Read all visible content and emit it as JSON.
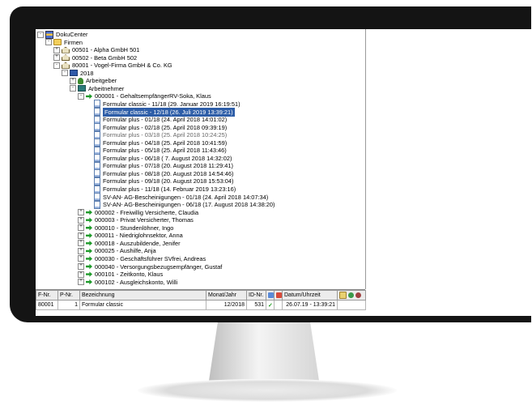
{
  "tree": [
    {
      "label": "DokuCenter",
      "icon": "database-icon",
      "level": 0,
      "exp": "-"
    },
    {
      "label": "Firmen",
      "icon": "folder-icon",
      "level": 1,
      "exp": "-"
    },
    {
      "label": "00501 - Alpha GmbH 501",
      "icon": "building-icon",
      "level": 2,
      "exp": "+"
    },
    {
      "label": "00502 - Beta GmbH 502",
      "icon": "building-icon",
      "level": 2,
      "exp": "+"
    },
    {
      "label": "80001 - Vogel-Firma GmbH & Co. KG",
      "icon": "building-icon",
      "level": 2,
      "exp": "-"
    },
    {
      "label": "2018",
      "icon": "calendar-folder-icon",
      "level": 3,
      "exp": "-"
    },
    {
      "label": "Arbeitgeber",
      "icon": "employer-icon",
      "level": 4,
      "exp": "+"
    },
    {
      "label": "Arbeitnehmer",
      "icon": "employees-icon",
      "level": 4,
      "exp": "-"
    },
    {
      "label": "000001 - GehaltsempfängerRV-Soka, Klaus",
      "icon": "arrow-icon",
      "level": 5,
      "exp": "-"
    },
    {
      "label": "Formular classic - 11/18  (29. Januar 2019 16:19:51)",
      "icon": "document-icon",
      "level": 6
    },
    {
      "label": "Formular classic - 12/18  (26. Juli 2019 13:39:21)",
      "icon": "document-icon",
      "level": 6,
      "selected": true
    },
    {
      "label": "Formular plus - 01/18  (24. April 2018 14:01:02)",
      "icon": "document-icon",
      "level": 6
    },
    {
      "label": "Formular plus - 02/18  (25. April 2018 09:39:19)",
      "icon": "document-icon",
      "level": 6
    },
    {
      "label": "Formular plus - 03/18  (25. April 2018 10:24:25)",
      "icon": "document-icon",
      "level": 6,
      "dim": true
    },
    {
      "label": "Formular plus - 04/18  (25. April 2018 10:41:59)",
      "icon": "document-icon",
      "level": 6
    },
    {
      "label": "Formular plus - 05/18  (25. April 2018 11:43:46)",
      "icon": "document-icon",
      "level": 6
    },
    {
      "label": "Formular plus - 06/18  ( 7. August 2018 14:32:02)",
      "icon": "document-icon",
      "level": 6
    },
    {
      "label": "Formular plus - 07/18  (20. August 2018 11:29:41)",
      "icon": "document-icon",
      "level": 6
    },
    {
      "label": "Formular plus - 08/18  (20. August 2018 14:54:46)",
      "icon": "document-icon",
      "level": 6
    },
    {
      "label": "Formular plus - 09/18  (20. August 2018 15:53:04)",
      "icon": "document-icon",
      "level": 6
    },
    {
      "label": "Formular plus - 11/18  (14. Februar 2019 13:23:16)",
      "icon": "document-icon",
      "level": 6
    },
    {
      "label": "SV-AN- AG-Bescheinigungen - 01/18  (24. April 2018 14:07:34)",
      "icon": "document-icon",
      "level": 6
    },
    {
      "label": "SV-AN- AG-Bescheinigungen - 06/18  (17. August 2018 14:38:20)",
      "icon": "document-icon",
      "level": 6
    },
    {
      "label": "000002 - Freiwillig Versicherte, Claudia",
      "icon": "arrow-icon",
      "level": 5,
      "exp": "+"
    },
    {
      "label": "000003 - Privat Versicherter, Thomas",
      "icon": "arrow-icon",
      "level": 5,
      "exp": "+"
    },
    {
      "label": "000010 - Stundenlöhner, Ingo",
      "icon": "arrow-icon",
      "level": 5,
      "exp": "+"
    },
    {
      "label": "000011 - Niedriglohnsektor, Anna",
      "icon": "arrow-icon",
      "level": 5,
      "exp": "+"
    },
    {
      "label": "000018 - Auszubildende, Jenifer",
      "icon": "arrow-icon",
      "level": 5,
      "exp": "+"
    },
    {
      "label": "000025 - Aushilfe, Anja",
      "icon": "arrow-icon",
      "level": 5,
      "exp": "+"
    },
    {
      "label": "000030 - Geschäftsführer SVfrei, Andreas",
      "icon": "arrow-icon",
      "level": 5,
      "exp": "+"
    },
    {
      "label": "000040 - Versorgungsbezugsempfänger, Gustaf",
      "icon": "arrow-icon",
      "level": 5,
      "exp": "+"
    },
    {
      "label": "000101 - Zeitkonto, Klaus",
      "icon": "arrow-icon",
      "level": 5,
      "exp": "+"
    },
    {
      "label": "000102 - Ausgleichskonto, Willi",
      "icon": "arrow-icon",
      "level": 5,
      "exp": "+"
    }
  ],
  "grid": {
    "headers": {
      "fnr": "F-Nr.",
      "pnr": "P-Nr.",
      "bezeichnung": "Bezeichnung",
      "monat_jahr": "Monat/Jahr",
      "id_nr": "ID-Nr.",
      "datum": "Datum/Uhrzeit"
    },
    "row": {
      "fnr": "80001",
      "pnr": "1",
      "bezeichnung": "Formular classic",
      "monat_jahr": "12/2018",
      "id_nr": "531",
      "check": "✓",
      "datum": "26.07.19 - 13:39:21"
    }
  },
  "colors": {
    "selection": "#2e5ea8",
    "check": "#1a9a1a"
  }
}
